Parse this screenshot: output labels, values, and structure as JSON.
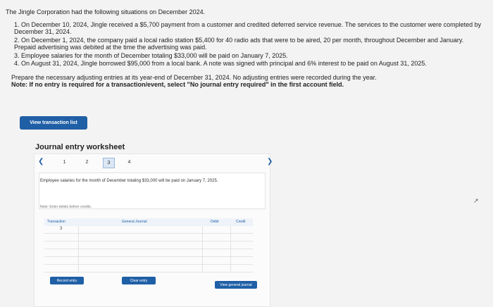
{
  "problem": {
    "intro": "The Jingle Corporation had the following situations on December 2024.",
    "items": [
      "1. On December 10, 2024, Jingle received a $5,700 payment from a customer and credited deferred service revenue. The services to the customer were completed by December 31, 2024.",
      "2. On December 1, 2024, the company paid a local radio station $5,400 for 40 radio ads that were to be aired, 20 per month, throughout December and January. Prepaid advertising was debited at the time the advertising was paid.",
      "3. Employee salaries for the month of December totaling $33,000 will be paid on January 7, 2025.",
      "4. On August 31, 2024, Jingle borrowed $95,000 from a local bank. A note was signed with principal and 6% interest to be paid on August 31, 2025."
    ],
    "prepare": "Prepare the necessary adjusting entries at its year-end of December 31, 2024. No adjusting entries were recorded during the year.",
    "note": "Note: If no entry is required for a transaction/event, select \"No journal entry required\" in the first account field."
  },
  "buttons": {
    "view_transaction_list": "View transaction list",
    "record_entry": "Record entry",
    "clear_entry": "Clear entry",
    "view_general_journal": "View general journal"
  },
  "worksheet": {
    "title": "Journal entry worksheet",
    "steps": [
      "1",
      "2",
      "3",
      "4"
    ],
    "active_step": "3",
    "description": "Employee salaries for the month of December totaling $33,000 will be paid on January 7, 2025.",
    "debit_note": "Note: Enter debits before credits.",
    "columns": {
      "transaction": "Transaction",
      "general_journal": "General Journal",
      "debit": "Debit",
      "credit": "Credit"
    },
    "transaction_number": "3"
  }
}
